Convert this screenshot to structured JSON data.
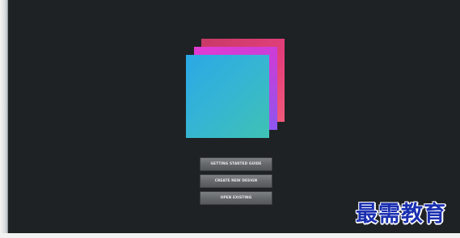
{
  "app": {
    "logo_icon": "app-logo-icon",
    "colors": {
      "background": "#1f2224",
      "logo_front": "#2aa8e5",
      "logo_middle": "#e23bd3",
      "logo_back": "#c73a66",
      "button_text": "#e9e9e9"
    }
  },
  "welcome": {
    "buttons": [
      {
        "label": "GETTING STARTED GUIDE"
      },
      {
        "label": "CREATE NEW DESIGN"
      },
      {
        "label": "OPEN EXISTING"
      }
    ]
  },
  "watermark": {
    "text": "最需教育"
  }
}
